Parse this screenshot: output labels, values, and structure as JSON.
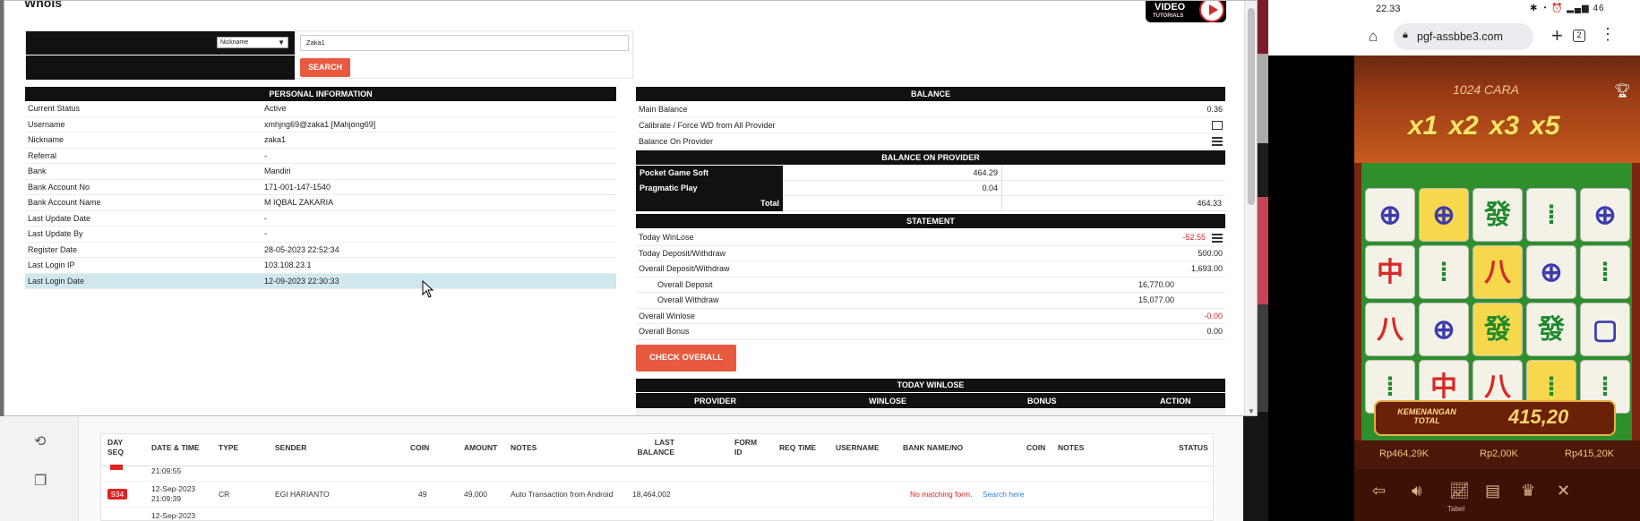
{
  "modal": {
    "title": "WhoIs",
    "video_logo_line1": "VIDEO",
    "video_logo_line2": "TUTORIALS",
    "search": {
      "select_value": "Nickname",
      "input_value": "Zaka1",
      "button_label": "SEARCH"
    },
    "personal": {
      "header": "PERSONAL INFORMATION",
      "rows": [
        {
          "label": "Current Status",
          "value": "Active"
        },
        {
          "label": "Username",
          "value": "xmhjng69@zaka1  [Mahjong69]"
        },
        {
          "label": "Nickname",
          "value": "zaka1"
        },
        {
          "label": "Referral",
          "value": "-"
        },
        {
          "label": "Bank",
          "value": "Mandiri"
        },
        {
          "label": "Bank Account No",
          "value": "171-001-147-1540"
        },
        {
          "label": "Bank Account Name",
          "value": "M IQBAL ZAKARIA"
        },
        {
          "label": "Last Update Date",
          "value": "-"
        },
        {
          "label": "Last Update By",
          "value": "-"
        },
        {
          "label": "Register Date",
          "value": "28-05-2023 22:52:34"
        },
        {
          "label": "Last Login IP",
          "value": "103.108.23.1"
        },
        {
          "label": "Last Login Date",
          "value": "12-09-2023 22:30:33"
        }
      ]
    },
    "balance": {
      "header": "BALANCE",
      "main_balance_label": "Main Balance",
      "main_balance_value": "0.36",
      "calibrate_label": "Calibrate / Force WD from All Provider",
      "bop_label": "Balance On Provider",
      "provider_header": "BALANCE ON PROVIDER",
      "providers": [
        {
          "name": "Pocket Game Soft",
          "value": "464.29"
        },
        {
          "name": "Pragmatic Play",
          "value": "0.04"
        }
      ],
      "total_label": "Total",
      "total_value": "464.33"
    },
    "statement": {
      "header": "STATEMENT",
      "today_winlose_label": "Today WinLose",
      "today_winlose_value": "-52.55",
      "today_dw_label": "Today Deposit/Withdraw",
      "today_dw_value": "500.00",
      "overall_dw_label": "Overall Deposit/Withdraw",
      "overall_dw_value": "1,693.00",
      "overall_deposit_label": "Overall Deposit",
      "overall_deposit_value": "16,770.00",
      "overall_withdraw_label": "Overall Withdraw",
      "overall_withdraw_value": "15,077.00",
      "overall_winlose_label": "Overall Winlose",
      "overall_winlose_value": "-0.00",
      "overall_bonus_label": "Overall Bonus",
      "overall_bonus_value": "0.00",
      "check_button": "CHECK OVERALL"
    },
    "today_winlose": {
      "header": "TODAY WINLOSE",
      "columns": [
        "PROVIDER",
        "WINLOSE",
        "BONUS",
        "ACTION"
      ]
    }
  },
  "background_table": {
    "headers": {
      "day_seq": "DAY SEQ",
      "date_time": "DATE & TIME",
      "type": "TYPE",
      "sender": "SENDER",
      "coin": "COIN",
      "amount": "AMOUNT",
      "notes": "NOTES",
      "last_balance": "LAST BALANCE",
      "form_id": "FORM ID",
      "req_time": "REQ TIME",
      "username": "USERNAME",
      "bank": "BANK NAME/NO",
      "coin2": "COIN",
      "notes2": "NOTES",
      "status": "STATUS"
    },
    "partial_time": "21:09:55",
    "row": {
      "seq": "934",
      "date": "12-Sep-2023",
      "time": "21:09:39",
      "type": "CR",
      "sender": "EGI HARIANTO",
      "coin": "49",
      "amount": "49,000",
      "notes": "Auto Transaction from Android",
      "last_balance": "18,464,002",
      "no_match": "No matching form.",
      "search_link": "Search here"
    },
    "partial_date": "12-Sep-2023"
  },
  "phone": {
    "time": "22.33",
    "status_icons": "✱ ◔ ⏰ ▂▄▆ 46",
    "url": "pgf-assbbe3.com",
    "tab_count": "2",
    "game": {
      "cara": "1024 CARA",
      "multipliers": [
        "x1",
        "x2",
        "x3",
        "x5"
      ],
      "win_label": "KEMENANGAN TOTAL",
      "win_amount": "415,20",
      "balance": "Rp464,29K",
      "bet": "Rp2,00K",
      "win": "Rp415,20K",
      "tabel_label": "Tabel"
    }
  }
}
